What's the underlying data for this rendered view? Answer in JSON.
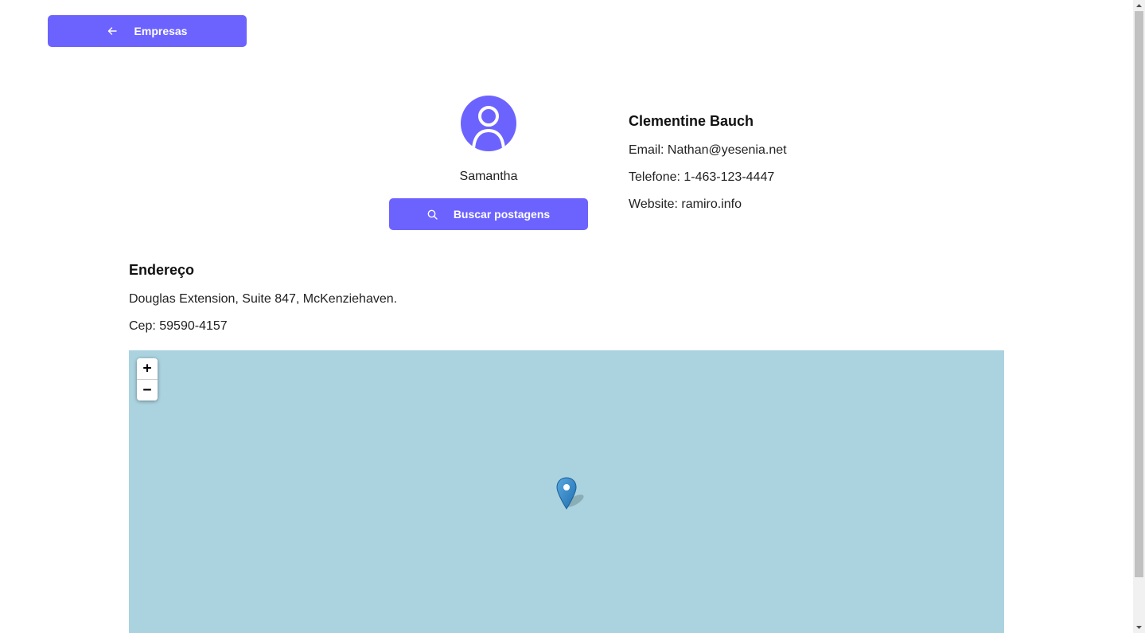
{
  "header": {
    "back_label": "Empresas",
    "back_icon": "arrow-left-icon"
  },
  "profile": {
    "avatar_icon": "user-avatar-icon",
    "avatar_color": "#6c63ff",
    "username": "Samantha",
    "search_label": "Buscar postagens",
    "search_icon": "search-icon"
  },
  "company": {
    "name": "Clementine Bauch",
    "email": "Email: Nathan@yesenia.net",
    "phone": "Telefone: 1-463-123-4447",
    "website": "Website: ramiro.info"
  },
  "address": {
    "title": "Endereço",
    "street": "Douglas Extension, Suite 847, McKenziehaven.",
    "cep": "Cep: 59590-4157"
  },
  "map": {
    "background_color": "#aad3df",
    "zoom_in": "+",
    "zoom_out": "−",
    "marker_icon": "map-marker-icon"
  },
  "theme": {
    "accent": "#6c63ff"
  }
}
